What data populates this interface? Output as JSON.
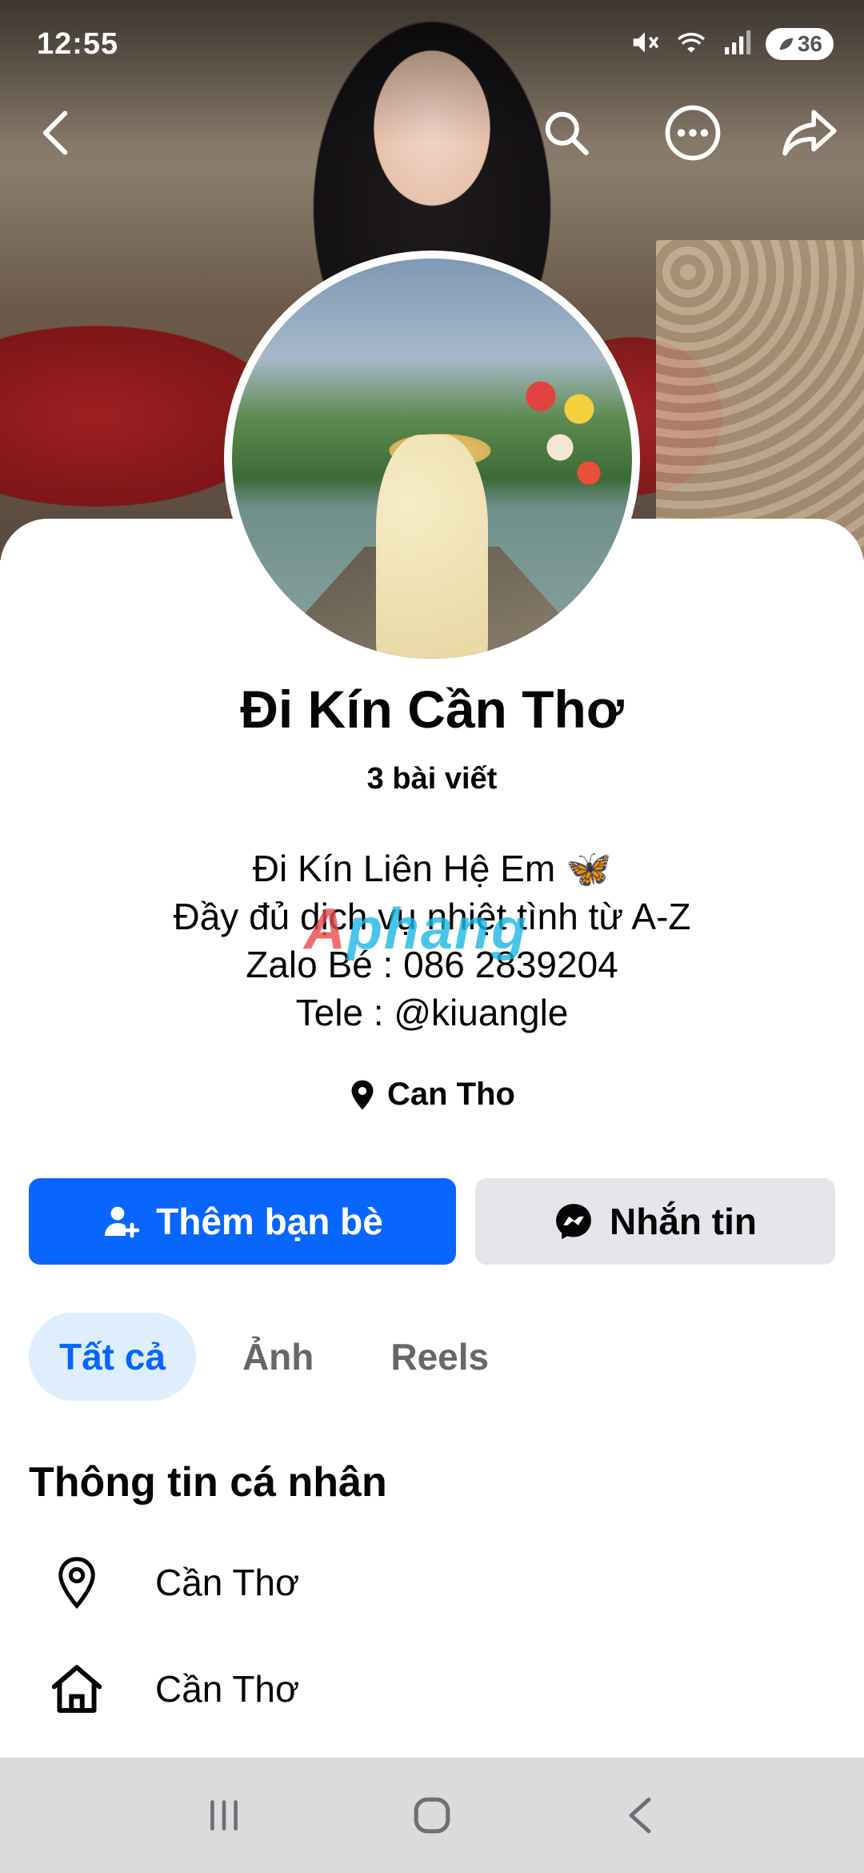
{
  "status_bar": {
    "time": "12:55",
    "battery": "36",
    "icons": [
      "mute-icon",
      "wifi-icon",
      "signal-icon",
      "battery-icon"
    ]
  },
  "top_nav": {
    "icons": [
      "back-icon",
      "search-icon",
      "more-icon",
      "share-icon"
    ]
  },
  "profile": {
    "name": "Đi Kín Cần Thơ",
    "post_count": "3 bài viết",
    "bio": [
      "Đi Kín Liên Hệ Em 🦋",
      "Đầy đủ dịch vụ nhiệt tình từ A-Z",
      "Zalo Bé : 086 2839204",
      "Tele : @kiuangle"
    ],
    "location": "Can Tho",
    "watermark": {
      "part1": "A",
      "part2": "phang"
    }
  },
  "actions": {
    "add_friend": "Thêm bạn bè",
    "message": "Nhắn tin"
  },
  "tabs": [
    {
      "label": "Tất cả",
      "active": true
    },
    {
      "label": "Ảnh",
      "active": false
    },
    {
      "label": "Reels",
      "active": false
    }
  ],
  "intro": {
    "title": "Thông tin cá nhân",
    "items": [
      {
        "icon": "location-pin-icon",
        "text": "Cần Thơ"
      },
      {
        "icon": "home-icon",
        "text": "Cần Thơ"
      }
    ]
  },
  "system_nav": {
    "icons": [
      "recent-apps-icon",
      "home-circle-icon",
      "system-back-icon"
    ]
  },
  "colors": {
    "primary": "#0866ff",
    "secondary_button": "#e4e6eb",
    "active_tab_bg": "#dfeefd",
    "text": "#050505",
    "muted_text": "#65676b",
    "nav_bar": "#dadbdd"
  }
}
